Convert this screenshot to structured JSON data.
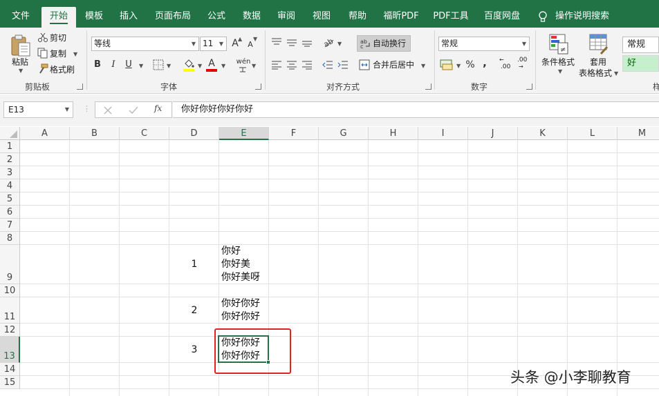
{
  "menu": {
    "tabs": [
      "文件",
      "开始",
      "模板",
      "插入",
      "页面布局",
      "公式",
      "数据",
      "审阅",
      "视图",
      "帮助",
      "福昕PDF",
      "PDF工具",
      "百度网盘"
    ],
    "active": "开始",
    "search": "操作说明搜索"
  },
  "ribbon": {
    "clipboard": {
      "paste": "粘贴",
      "cut": "剪切",
      "copy": "复制",
      "format_painter": "格式刷",
      "group": "剪贴板"
    },
    "font": {
      "name": "等线",
      "size": "11",
      "bold": "B",
      "italic": "I",
      "underline": "U",
      "grow": "A",
      "shrink": "A",
      "font_color_letter": "A",
      "phonetic": "wén",
      "group": "字体"
    },
    "alignment": {
      "wrap_text": "自动换行",
      "merge_center": "合并后居中",
      "group": "对齐方式"
    },
    "number": {
      "format": "常规",
      "percent": "%",
      "comma": ",",
      "inc_decimal": ".00",
      "dec_decimal": ".00",
      "group": "数字"
    },
    "styles": {
      "conditional": "条件格式",
      "table_format_1": "套用",
      "table_format_2": "表格格式",
      "style_normal": "常规",
      "style_good": "好",
      "group_partial": "样"
    }
  },
  "formula_bar": {
    "name_box": "E13",
    "fx": "fx",
    "content": "你好你好你好你好"
  },
  "columns": [
    "A",
    "B",
    "C",
    "D",
    "E",
    "F",
    "G",
    "H",
    "I",
    "J",
    "K",
    "L",
    "M"
  ],
  "selected_column": "E",
  "rows": [
    "1",
    "2",
    "3",
    "4",
    "5",
    "6",
    "7",
    "8",
    "9",
    "10",
    "11",
    "12",
    "13",
    "14",
    "15"
  ],
  "selected_row": "13",
  "cells": {
    "d9": "1",
    "e9": [
      "你好",
      "你好美",
      "你好美呀"
    ],
    "d11": "2",
    "e11": [
      "你好你好",
      "你好你好"
    ],
    "d13": "3",
    "e13": [
      "你好你好",
      "你好你好"
    ]
  },
  "watermark": "头条 @小李聊教育",
  "colors": {
    "excel_green": "#217346",
    "annotation_red": "#e3201b",
    "good_style_bg": "#c6efce"
  }
}
